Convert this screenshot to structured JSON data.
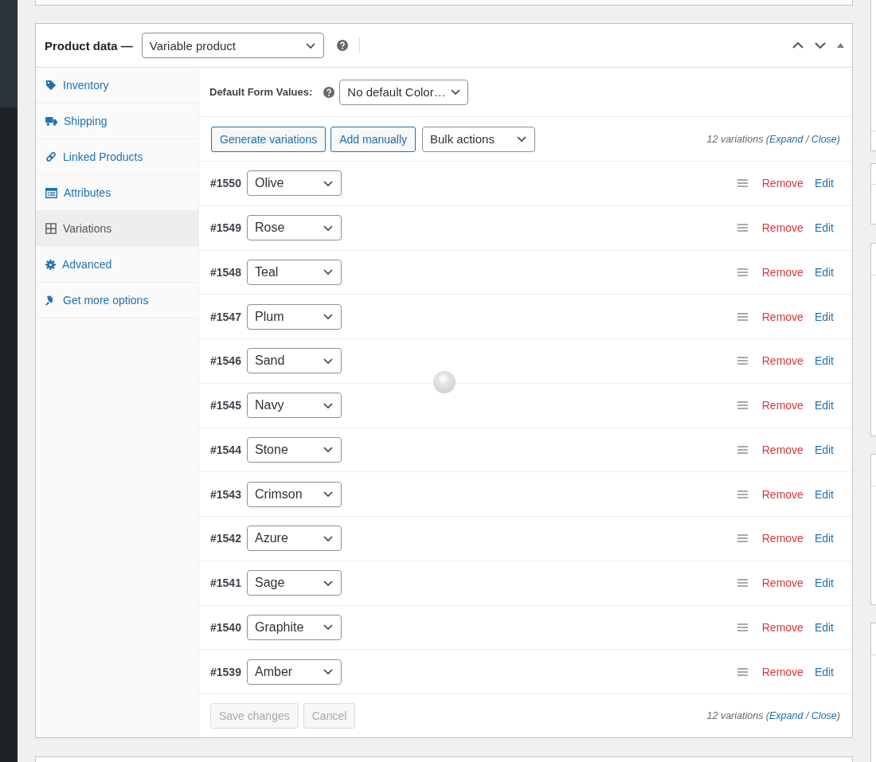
{
  "product_data": {
    "title": "Product data —",
    "type_select": "Variable product"
  },
  "tabs": [
    {
      "label": "Inventory",
      "selected": false
    },
    {
      "label": "Shipping",
      "selected": false
    },
    {
      "label": "Linked Products",
      "selected": false
    },
    {
      "label": "Attributes",
      "selected": false
    },
    {
      "label": "Variations",
      "selected": true
    },
    {
      "label": "Advanced",
      "selected": false
    },
    {
      "label": "Get more options",
      "selected": false
    }
  ],
  "default_form_values": {
    "label": "Default Form Values:",
    "select": "No default Color…"
  },
  "toolbar": {
    "buttons": [
      {
        "label": "Generate variations",
        "disabled": false
      },
      {
        "label": "Add manually",
        "disabled": false
      }
    ],
    "bulk_actions": "Bulk actions",
    "summary": {
      "count": "12 variations",
      "open": "(",
      "expand": "Expand",
      "separator": "/",
      "close": "Close",
      "end": ")"
    }
  },
  "variations": [
    {
      "id": "#1550",
      "attribute": "Olive",
      "remove": "Remove",
      "edit": "Edit"
    },
    {
      "id": "#1549",
      "attribute": "Rose",
      "remove": "Remove",
      "edit": "Edit"
    },
    {
      "id": "#1548",
      "attribute": "Teal",
      "remove": "Remove",
      "edit": "Edit"
    },
    {
      "id": "#1547",
      "attribute": "Plum",
      "remove": "Remove",
      "edit": "Edit"
    },
    {
      "id": "#1546",
      "attribute": "Sand",
      "remove": "Remove",
      "edit": "Edit"
    },
    {
      "id": "#1545",
      "attribute": "Navy",
      "remove": "Remove",
      "edit": "Edit"
    },
    {
      "id": "#1544",
      "attribute": "Stone",
      "remove": "Remove",
      "edit": "Edit"
    },
    {
      "id": "#1543",
      "attribute": "Crimson",
      "remove": "Remove",
      "edit": "Edit"
    },
    {
      "id": "#1542",
      "attribute": "Azure",
      "remove": "Remove",
      "edit": "Edit"
    },
    {
      "id": "#1541",
      "attribute": "Sage",
      "remove": "Remove",
      "edit": "Edit"
    },
    {
      "id": "#1540",
      "attribute": "Graphite",
      "remove": "Remove",
      "edit": "Edit"
    },
    {
      "id": "#1539",
      "attribute": "Amber",
      "remove": "Remove",
      "edit": "Edit"
    }
  ],
  "footer": {
    "buttons": [
      {
        "label": "Save changes",
        "disabled": true
      },
      {
        "label": "Cancel",
        "disabled": true
      }
    ],
    "summary": {
      "count": "12 variations",
      "open": "(",
      "expand": "Expand",
      "separator": "/",
      "close": "Close",
      "end": ")"
    }
  }
}
